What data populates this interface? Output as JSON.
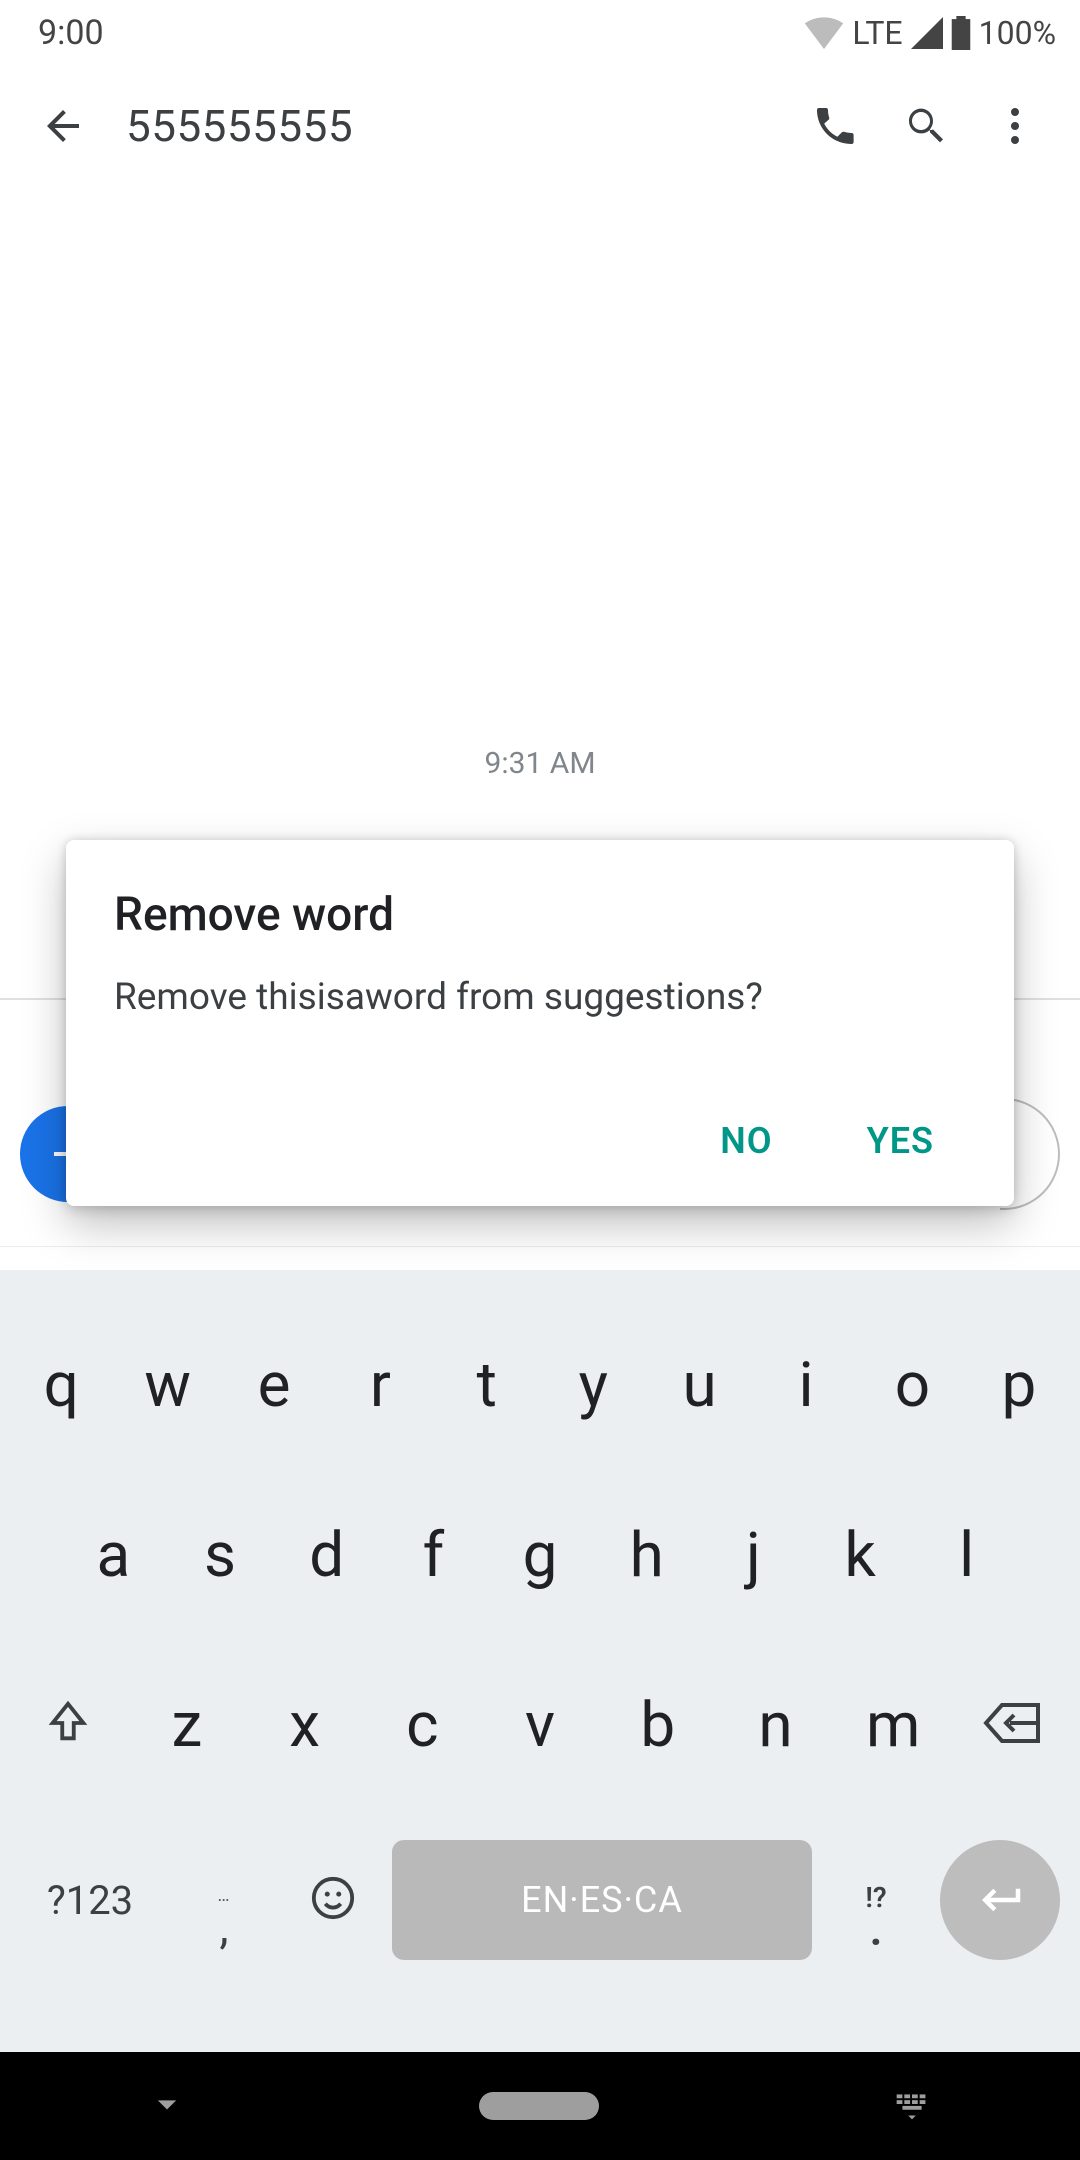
{
  "status": {
    "time": "9:00",
    "lte": "LTE",
    "battery": "100%"
  },
  "appbar": {
    "title": "555555555"
  },
  "conversation": {
    "timestamp": "9:31 AM"
  },
  "dialog": {
    "title": "Remove word",
    "body": "Remove thisisaword from suggestions?",
    "no": "NO",
    "yes": "YES"
  },
  "keyboard": {
    "row1": [
      "q",
      "w",
      "e",
      "r",
      "t",
      "y",
      "u",
      "i",
      "o",
      "p"
    ],
    "row2": [
      "a",
      "s",
      "d",
      "f",
      "g",
      "h",
      "j",
      "k",
      "l"
    ],
    "row3": [
      "z",
      "x",
      "c",
      "v",
      "b",
      "n",
      "m"
    ],
    "symbols": "?123",
    "comma_top": "…",
    "comma": ",",
    "space": "EN·ES·CA",
    "period_top": "!?",
    "period": "."
  }
}
